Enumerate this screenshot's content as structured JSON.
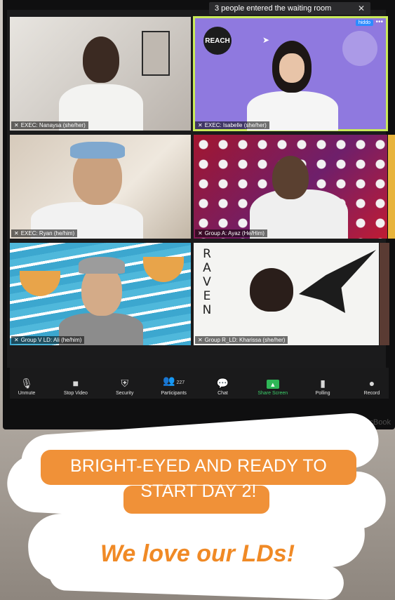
{
  "waiting_room": {
    "message": "3 people entered the waiting room",
    "close": "✕"
  },
  "participants": [
    {
      "label": "EXEC: Nanaysa (she/her)"
    },
    {
      "label": "EXEC: Isabelle (she/her)",
      "name_tag": "hiddo",
      "active_speaker": true
    },
    {
      "label": "EXEC: Ryan (he/him)"
    },
    {
      "label": "Group A: Ayaz (He/Him)"
    },
    {
      "label": "Group V LD: Ali (he/him)"
    },
    {
      "label": "Group R_LD: Kharissa (she/her)"
    }
  ],
  "tile_text": {
    "reach_logo": "REACH",
    "raven": [
      "R",
      "A",
      "V",
      "E",
      "N"
    ]
  },
  "toolbar": {
    "unmute": "Unmute",
    "stop_video": "Stop Video",
    "security": "Security",
    "participants": "Participants",
    "participants_count": "227",
    "chat": "Chat",
    "share_screen": "Share Screen",
    "polling": "Polling",
    "record": "Record"
  },
  "monitor_brand": "MacBook",
  "caption": {
    "line1": "BRIGHT-EYED AND READY TO",
    "line2": "START DAY 2!"
  },
  "tagline": "We love our LDs!",
  "colors": {
    "caption_bg": "#f09138",
    "tagline": "#f08a26",
    "active_outline": "#c9ea59",
    "share_green": "#2fb757"
  }
}
